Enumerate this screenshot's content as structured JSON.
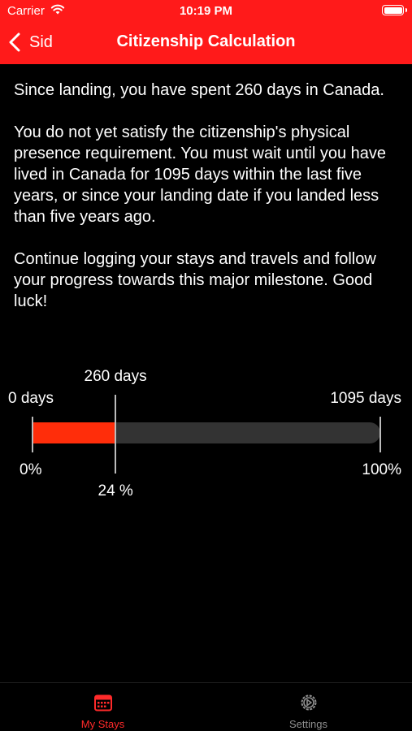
{
  "status_bar": {
    "carrier": "Carrier",
    "time": "10:19 PM"
  },
  "nav": {
    "back_label": "Sid",
    "title": "Citizenship Calculation"
  },
  "content": {
    "paragraphs": [
      "Since landing, you have spent 260 days in Canada.",
      "You do not yet satisfy the citizenship's physical presence requirement. You must wait until you have lived in Canada for 1095 days within the last five years, or since your landing date if you landed less than five years ago.",
      "Continue logging your stays and travels and follow your progress towards this major milestone. Good luck!"
    ]
  },
  "progress": {
    "current_label": "260 days",
    "start_label": "0 days",
    "end_label": "1095 days",
    "start_percent_label": "0%",
    "end_percent_label": "100%",
    "current_percent_label": "24 %",
    "current_days": 260,
    "required_days": 1095
  },
  "tabs": [
    {
      "label": "My Stays",
      "icon": "calendar-icon",
      "active": true
    },
    {
      "label": "Settings",
      "icon": "gear-icon",
      "active": false
    }
  ],
  "colors": {
    "accent": "#ff1a1a",
    "progress_fill": "#ff2d0a",
    "track": "#333333",
    "inactive": "#8e8e8e"
  }
}
